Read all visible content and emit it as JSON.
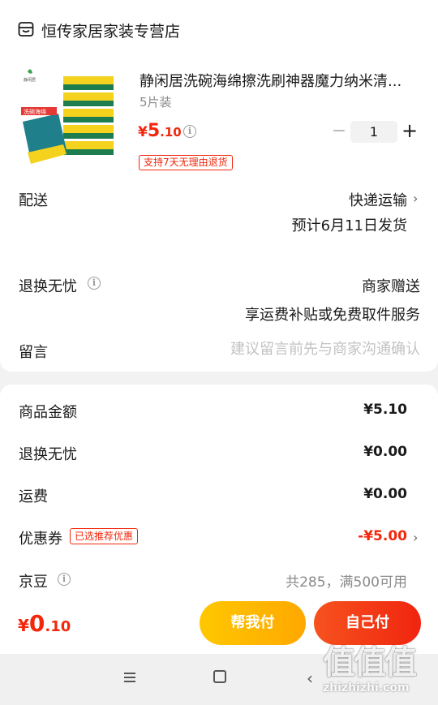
{
  "store": {
    "name": "恒传家居家装专营店",
    "icon": "store-icon"
  },
  "product": {
    "title": "静闲居洗碗海绵擦洗刷神器魔力纳米清...",
    "spec": "5片装",
    "price_currency": "¥",
    "price_int": "5",
    "price_dec": ".10",
    "quantity": "1",
    "minus": "−",
    "plus": "+",
    "return_tag": "支持7天无理由退货",
    "image_brand": "静闲居",
    "image_label": "洗碗海绵"
  },
  "shipping": {
    "label": "配送",
    "method": "快递运输",
    "date": "预计6月11日发货"
  },
  "return_service": {
    "label": "退换无忧",
    "line1": "商家赠送",
    "line2": "享运费补贴或免费取件服务"
  },
  "message": {
    "label": "留言",
    "placeholder": "建议留言前先与商家沟通确认"
  },
  "fees": {
    "goods_label": "商品金额",
    "goods_value": "¥5.10",
    "return_label": "退换无忧",
    "return_value": "¥0.00",
    "shipping_label": "运费",
    "shipping_value": "¥0.00",
    "coupon_label": "优惠券",
    "coupon_tag": "已选推荐优惠",
    "coupon_value": "-¥5.00",
    "bean_label": "京豆",
    "bean_text": "共285，满500可用"
  },
  "bottom": {
    "total_currency": "¥",
    "total_int": "0",
    "total_dec": ".10",
    "help_pay": "帮我付",
    "self_pay": "自己付"
  },
  "watermark": {
    "logo": "值值值",
    "url": "zhizhizhi.com"
  },
  "colors": {
    "accent": "#f2270c",
    "help_btn": "#ffb300",
    "self_btn": "#f3390f"
  }
}
